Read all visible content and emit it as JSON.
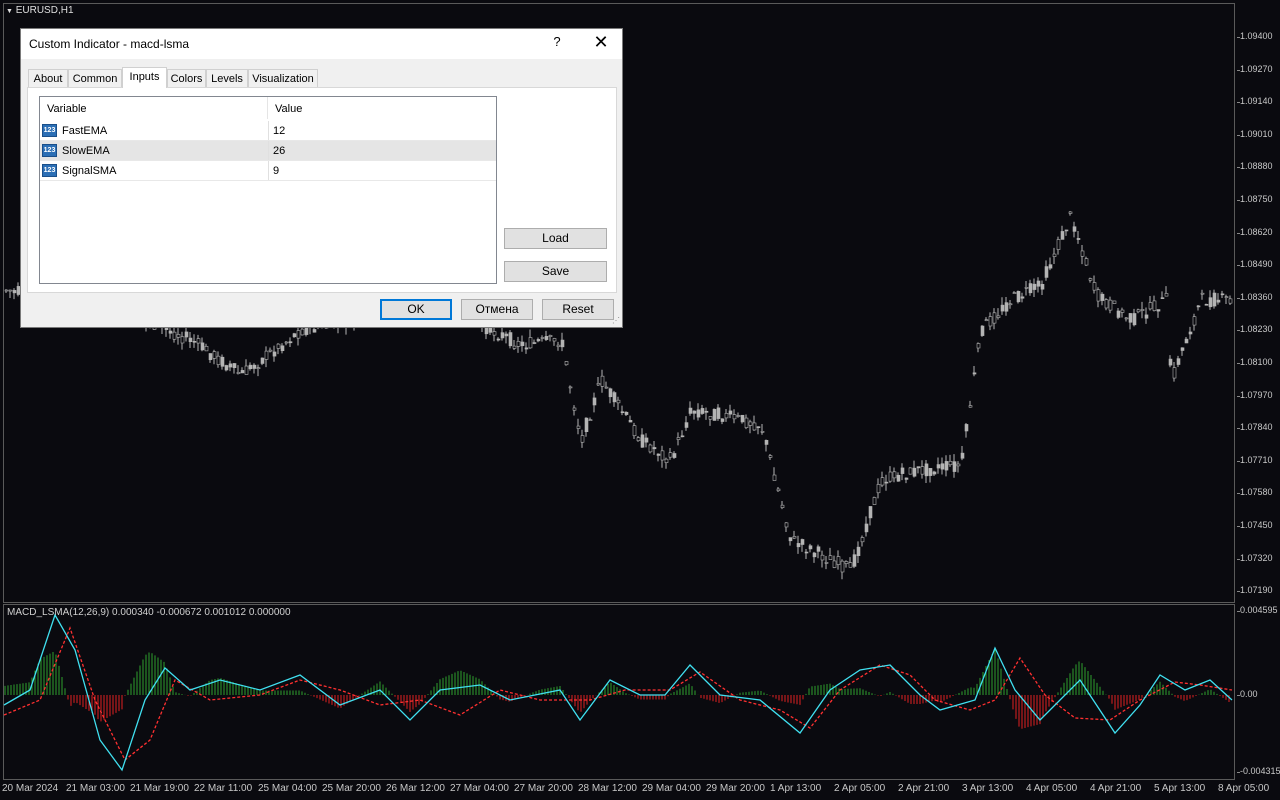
{
  "symbol_label": "EURUSD,H1",
  "indicator_label": "MACD_LSMA(12,26,9) 0.000340 -0.000672 0.001012 0.000000",
  "price_scale": [
    "1.09400",
    "1.09270",
    "1.09140",
    "1.09010",
    "1.08880",
    "1.08750",
    "1.08620",
    "1.08490",
    "1.08360",
    "1.08230",
    "1.08100",
    "1.07970",
    "1.07840",
    "1.07710",
    "1.07580",
    "1.07450",
    "1.07320",
    "1.07190"
  ],
  "indicator_scale": [
    "0.004595",
    "0.00",
    "-0.004315"
  ],
  "time_axis": [
    "20 Mar 2024",
    "21 Mar 03:00",
    "21 Mar 19:00",
    "22 Mar 11:00",
    "25 Mar 04:00",
    "25 Mar 20:00",
    "26 Mar 12:00",
    "27 Mar 04:00",
    "27 Mar 20:00",
    "28 Mar 12:00",
    "29 Mar 04:00",
    "29 Mar 20:00",
    "1 Apr 13:00",
    "2 Apr 05:00",
    "2 Apr 21:00",
    "3 Apr 13:00",
    "4 Apr 05:00",
    "4 Apr 21:00",
    "5 Apr 13:00",
    "8 Apr 05:00"
  ],
  "colors": {
    "background": "#0a0a0f",
    "candle": "#b4b4b4",
    "hist_up": "#2ea02e",
    "hist_down": "#e02020",
    "macd_line": "#40e0f0",
    "signal_line": "#ff3030"
  },
  "dialog": {
    "title": "Custom Indicator - macd-lsma",
    "help_icon": "?",
    "close_icon": "✕",
    "tabs": [
      {
        "label": "About"
      },
      {
        "label": "Common"
      },
      {
        "label": "Inputs"
      },
      {
        "label": "Colors"
      },
      {
        "label": "Levels"
      },
      {
        "label": "Visualization"
      }
    ],
    "active_tab": "Inputs",
    "grid": {
      "headers": [
        "Variable",
        "Value"
      ],
      "rows": [
        {
          "icon": "123",
          "name": "FastEMA",
          "value": "12"
        },
        {
          "icon": "123",
          "name": "SlowEMA",
          "value": "26"
        },
        {
          "icon": "123",
          "name": "SignalSMA",
          "value": "9"
        }
      ]
    },
    "load_label": "Load",
    "save_label": "Save",
    "ok_label": "OK",
    "cancel_label": "Отмена",
    "reset_label": "Reset"
  }
}
